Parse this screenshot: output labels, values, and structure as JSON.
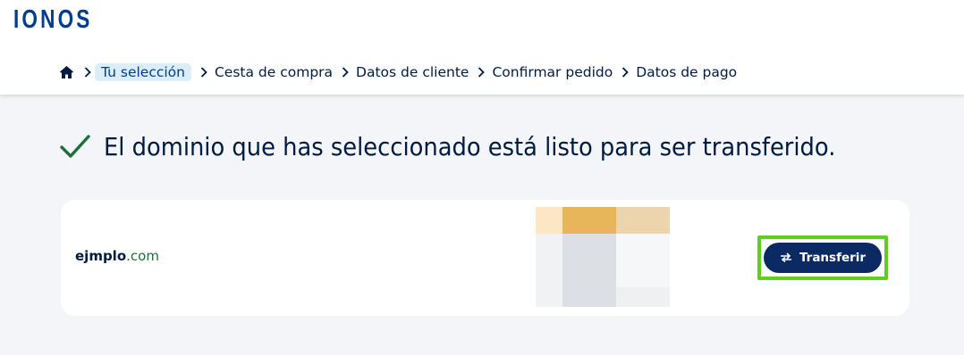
{
  "brand": {
    "logo_text": "IONOS"
  },
  "breadcrumb": {
    "home_icon": "home-icon",
    "items": [
      {
        "label": "Tu selección",
        "active": true
      },
      {
        "label": "Cesta de compra",
        "active": false
      },
      {
        "label": "Datos de cliente",
        "active": false
      },
      {
        "label": "Confirmar pedido",
        "active": false
      },
      {
        "label": "Datos de pago",
        "active": false
      }
    ]
  },
  "main": {
    "headline": "El dominio que has seleccionado está listo para ser transferido.",
    "status_icon": "check-icon"
  },
  "domain_card": {
    "domain_name": "ejmplo",
    "domain_tld": ".com",
    "action_button": {
      "label": "Transferir",
      "icon": "swap-arrows-icon"
    }
  },
  "colors": {
    "brand_blue": "#003d8f",
    "text_navy": "#001b41",
    "success_green": "#1e6f3a",
    "button_bg": "#0b2a63",
    "highlight_frame": "#5fcf1a",
    "active_crumb_bg": "#dbedf8",
    "page_bg": "#f3f5f8"
  }
}
